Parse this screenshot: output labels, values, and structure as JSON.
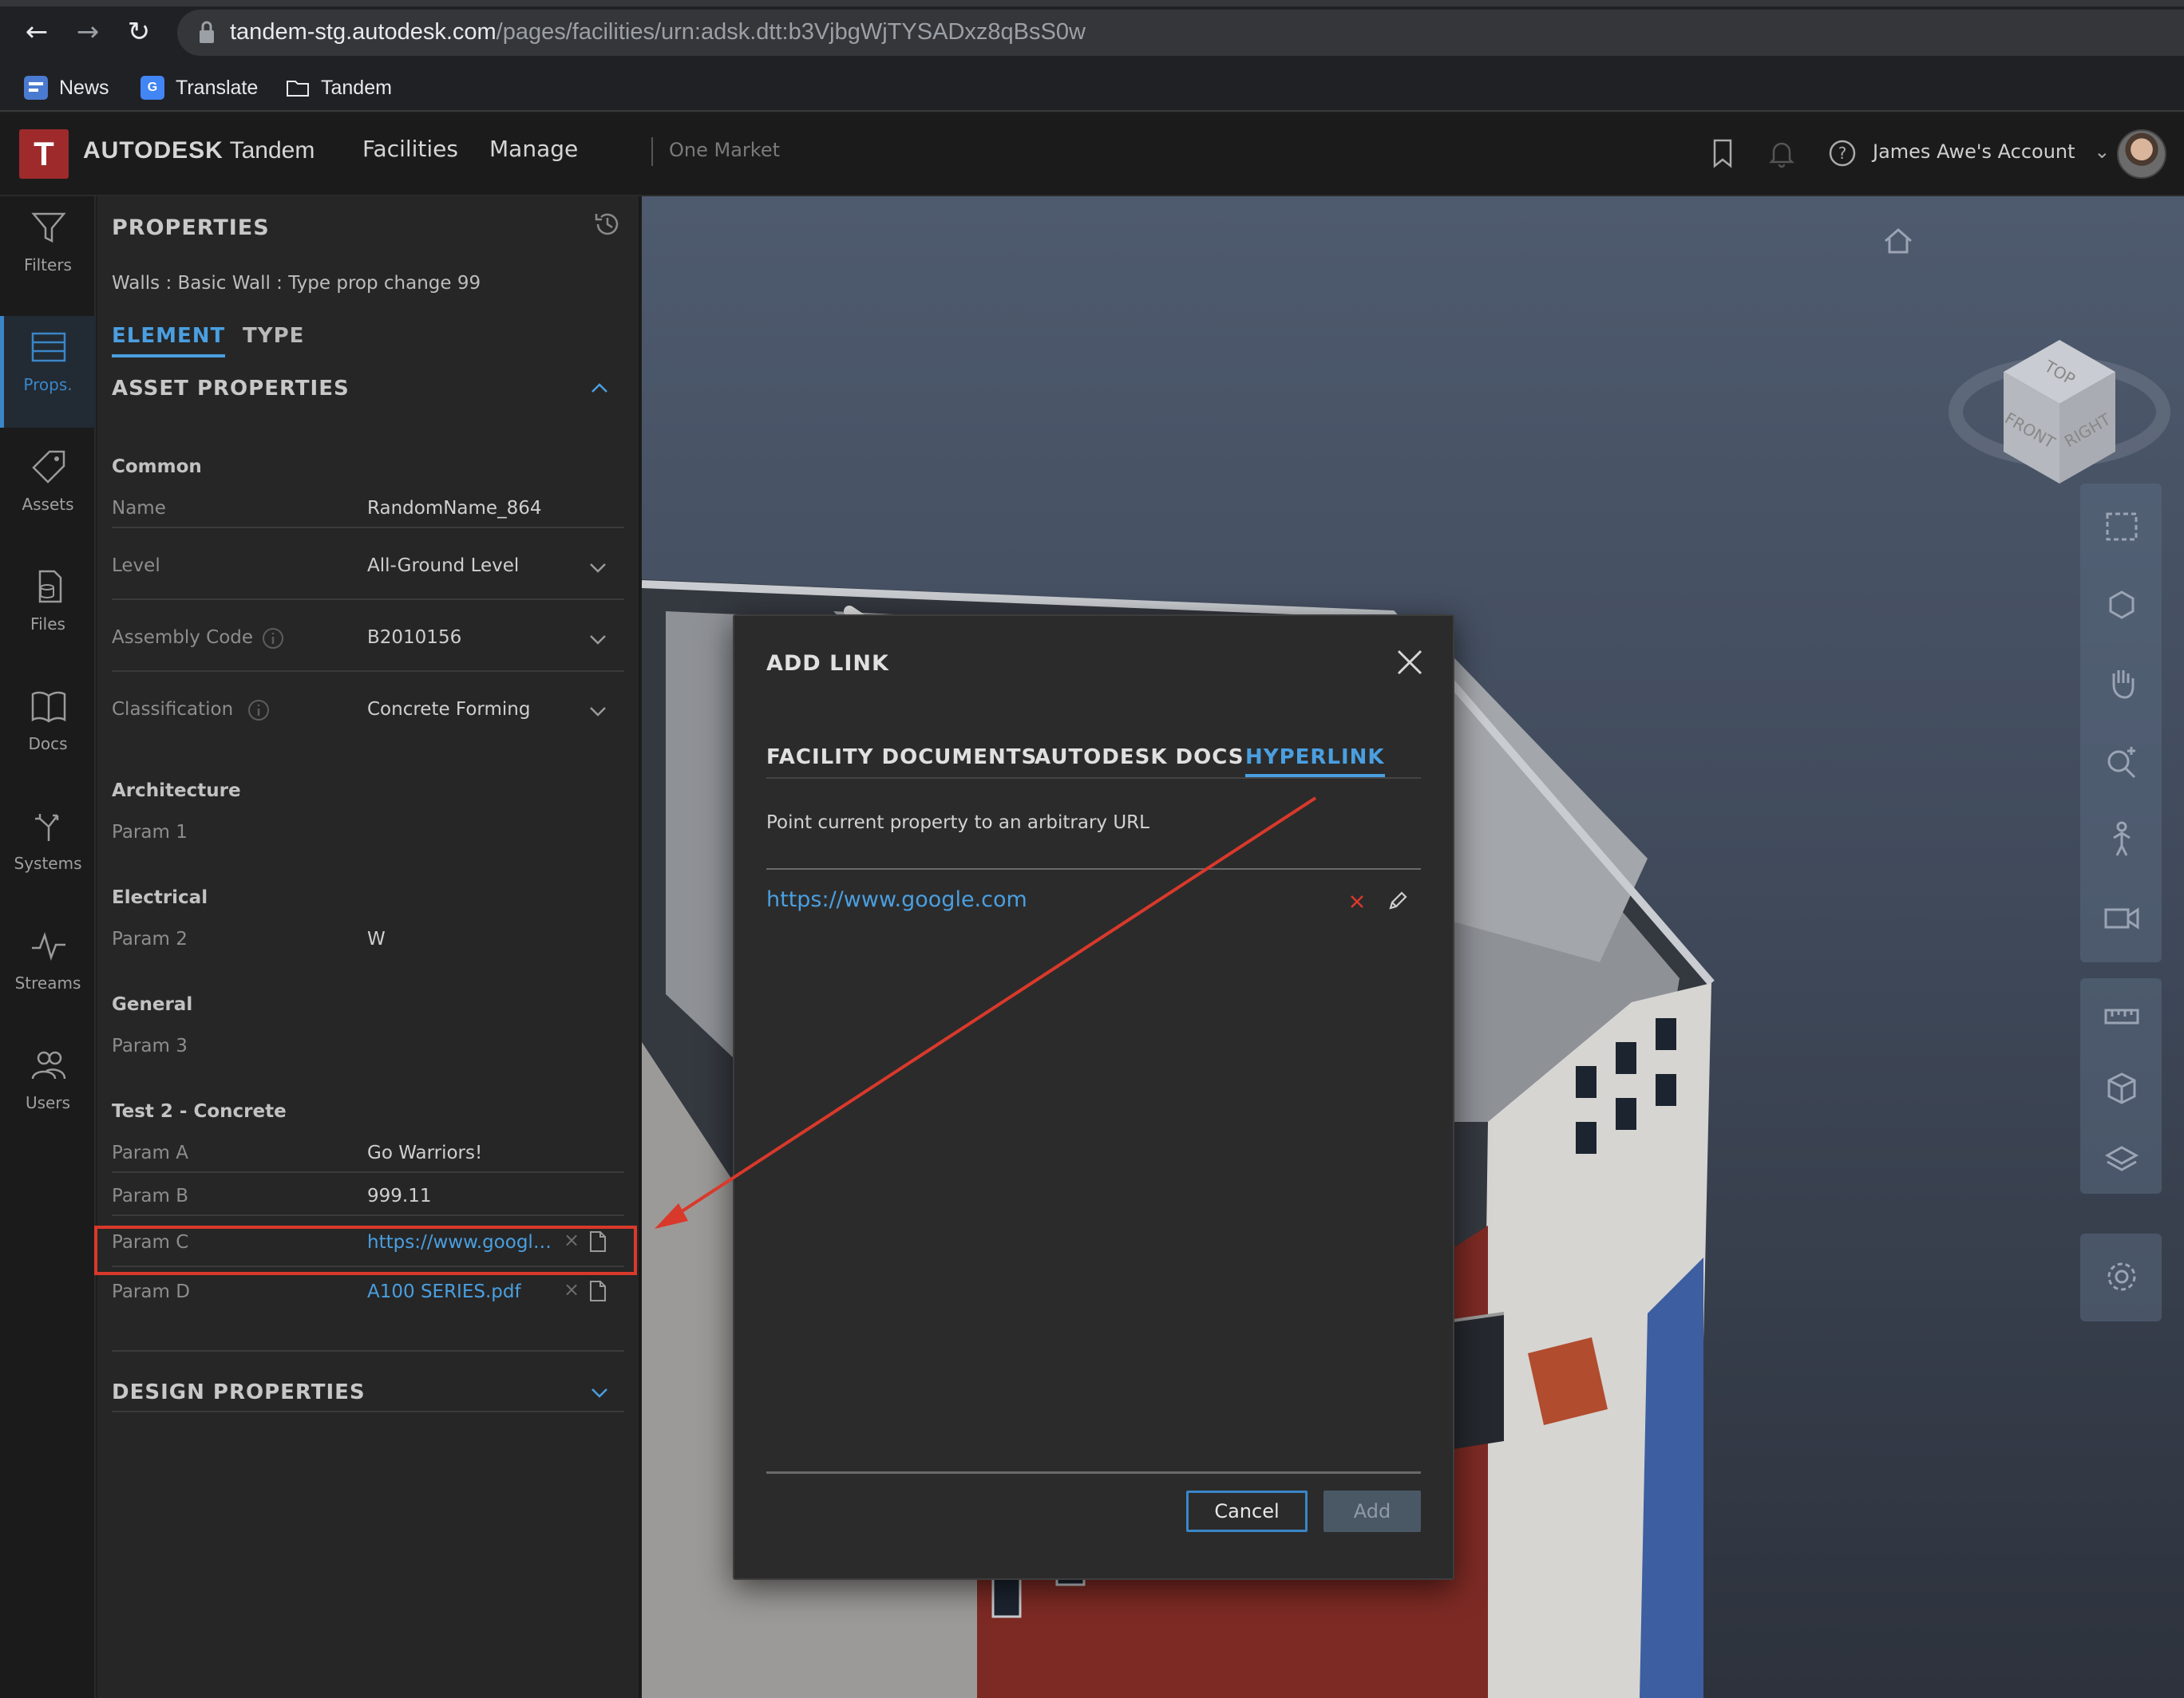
{
  "browser": {
    "url_host": "tandem-stg.autodesk.com",
    "url_path": "/pages/facilities/urn:adsk.dtt:b3VjbgWjTYSADxz8qBsS0w",
    "bookmarks": [
      {
        "label": "News",
        "icon": "news-icon"
      },
      {
        "label": "Translate",
        "icon": "translate-icon"
      },
      {
        "label": "Tandem",
        "icon": "folder-icon"
      }
    ]
  },
  "header": {
    "logo_letter": "T",
    "brand": "AUTODESK",
    "product": "Tandem",
    "nav": [
      "Facilities",
      "Manage"
    ],
    "facility": "One Market",
    "account": "James Awe's Account"
  },
  "rail": [
    {
      "label": "Filters",
      "icon": "filter-icon"
    },
    {
      "label": "Props.",
      "icon": "properties-icon",
      "active": true
    },
    {
      "label": "Assets",
      "icon": "tag-icon"
    },
    {
      "label": "Files",
      "icon": "files-icon"
    },
    {
      "label": "Docs",
      "icon": "book-icon"
    },
    {
      "label": "Systems",
      "icon": "systems-icon"
    },
    {
      "label": "Streams",
      "icon": "pulse-icon"
    },
    {
      "label": "Users",
      "icon": "users-icon"
    }
  ],
  "panel": {
    "title": "PROPERTIES",
    "element_name": "Walls : Basic Wall : Type prop change 99",
    "tabs": [
      "ELEMENT",
      "TYPE"
    ],
    "asset_section": "ASSET PROPERTIES",
    "design_section": "DESIGN PROPERTIES",
    "groups": {
      "common": "Common",
      "architecture": "Architecture",
      "electrical": "Electrical",
      "general": "General",
      "test2": "Test 2 - Concrete"
    },
    "props": {
      "name": {
        "label": "Name",
        "value": "RandomName_864"
      },
      "level": {
        "label": "Level",
        "value": "All-Ground Level"
      },
      "assembly": {
        "label": "Assembly Code",
        "value": "B2010156"
      },
      "classification": {
        "label": "Classification",
        "value": "Concrete Forming"
      },
      "param1": {
        "label": "Param 1",
        "value": ""
      },
      "param2": {
        "label": "Param 2",
        "value": "W"
      },
      "param3": {
        "label": "Param 3",
        "value": ""
      },
      "paramA": {
        "label": "Param A",
        "value": "Go Warriors!"
      },
      "paramB": {
        "label": "Param B",
        "value": "999.11"
      },
      "paramC": {
        "label": "Param C",
        "value": "https://www.google..."
      },
      "paramD": {
        "label": "Param D",
        "value": "A100 SERIES.pdf"
      }
    },
    "remove_glyph": "×"
  },
  "modal": {
    "title": "ADD LINK",
    "tabs": [
      "FACILITY DOCUMENTS",
      "AUTODESK DOCS",
      "HYPERLINK"
    ],
    "active_tab": "HYPERLINK",
    "description": "Point current property to an arbitrary URL",
    "hyperlink": "https://www.google.com",
    "cancel_label": "Cancel",
    "add_label": "Add"
  },
  "viewcube": {
    "top": "TOP",
    "front": "FRONT",
    "right": "RIGHT"
  },
  "colors": {
    "accent": "#4a9fe0",
    "highlight": "#d9392b",
    "logo": "#9e2a2b"
  }
}
